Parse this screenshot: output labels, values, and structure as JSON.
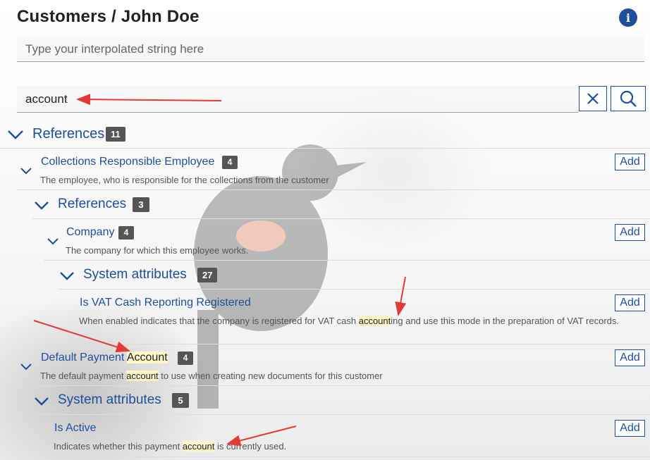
{
  "header": {
    "title": "Customers / John Doe",
    "info_icon": "info-icon"
  },
  "interpolated": {
    "placeholder": "Type your interpolated string here",
    "value": ""
  },
  "search": {
    "value": "account"
  },
  "colors": {
    "accent": "#1f4e9a",
    "badge": "#555555",
    "highlight": "#fdf6c8",
    "annotation": "#e53935"
  },
  "tree": {
    "references": {
      "label": "References",
      "count": "11"
    },
    "collections_employee": {
      "label": "Collections Responsible Employee",
      "count": "4",
      "description": "The employee, who is responsible for the collections from the customer",
      "add": "Add"
    },
    "references2": {
      "label": "References",
      "count": "3"
    },
    "company": {
      "label": "Company",
      "count": "4",
      "description": "The company for which this employee works.",
      "add": "Add"
    },
    "system_attributes1": {
      "label": "System attributes",
      "count": "27"
    },
    "vat_cash": {
      "label": "Is VAT Cash Reporting Registered",
      "desc_pre": "When enabled indicates that the company is registered for VAT cash ",
      "desc_hl": "account",
      "desc_post": "ing and use this mode in the preparation of VAT records.",
      "add": "Add"
    },
    "default_payment": {
      "label_pre": "Default Payment ",
      "label_hl": "Account",
      "count": "4",
      "desc_pre": "The default payment ",
      "desc_hl": "account",
      "desc_post": " to use when creating new documents for this customer",
      "add": "Add"
    },
    "system_attributes2": {
      "label": "System attributes",
      "count": "5"
    },
    "is_active": {
      "label": "Is Active",
      "desc_pre": "Indicates whether this payment ",
      "desc_hl": "account",
      "desc_post": " is currently used.",
      "add": "Add"
    }
  }
}
